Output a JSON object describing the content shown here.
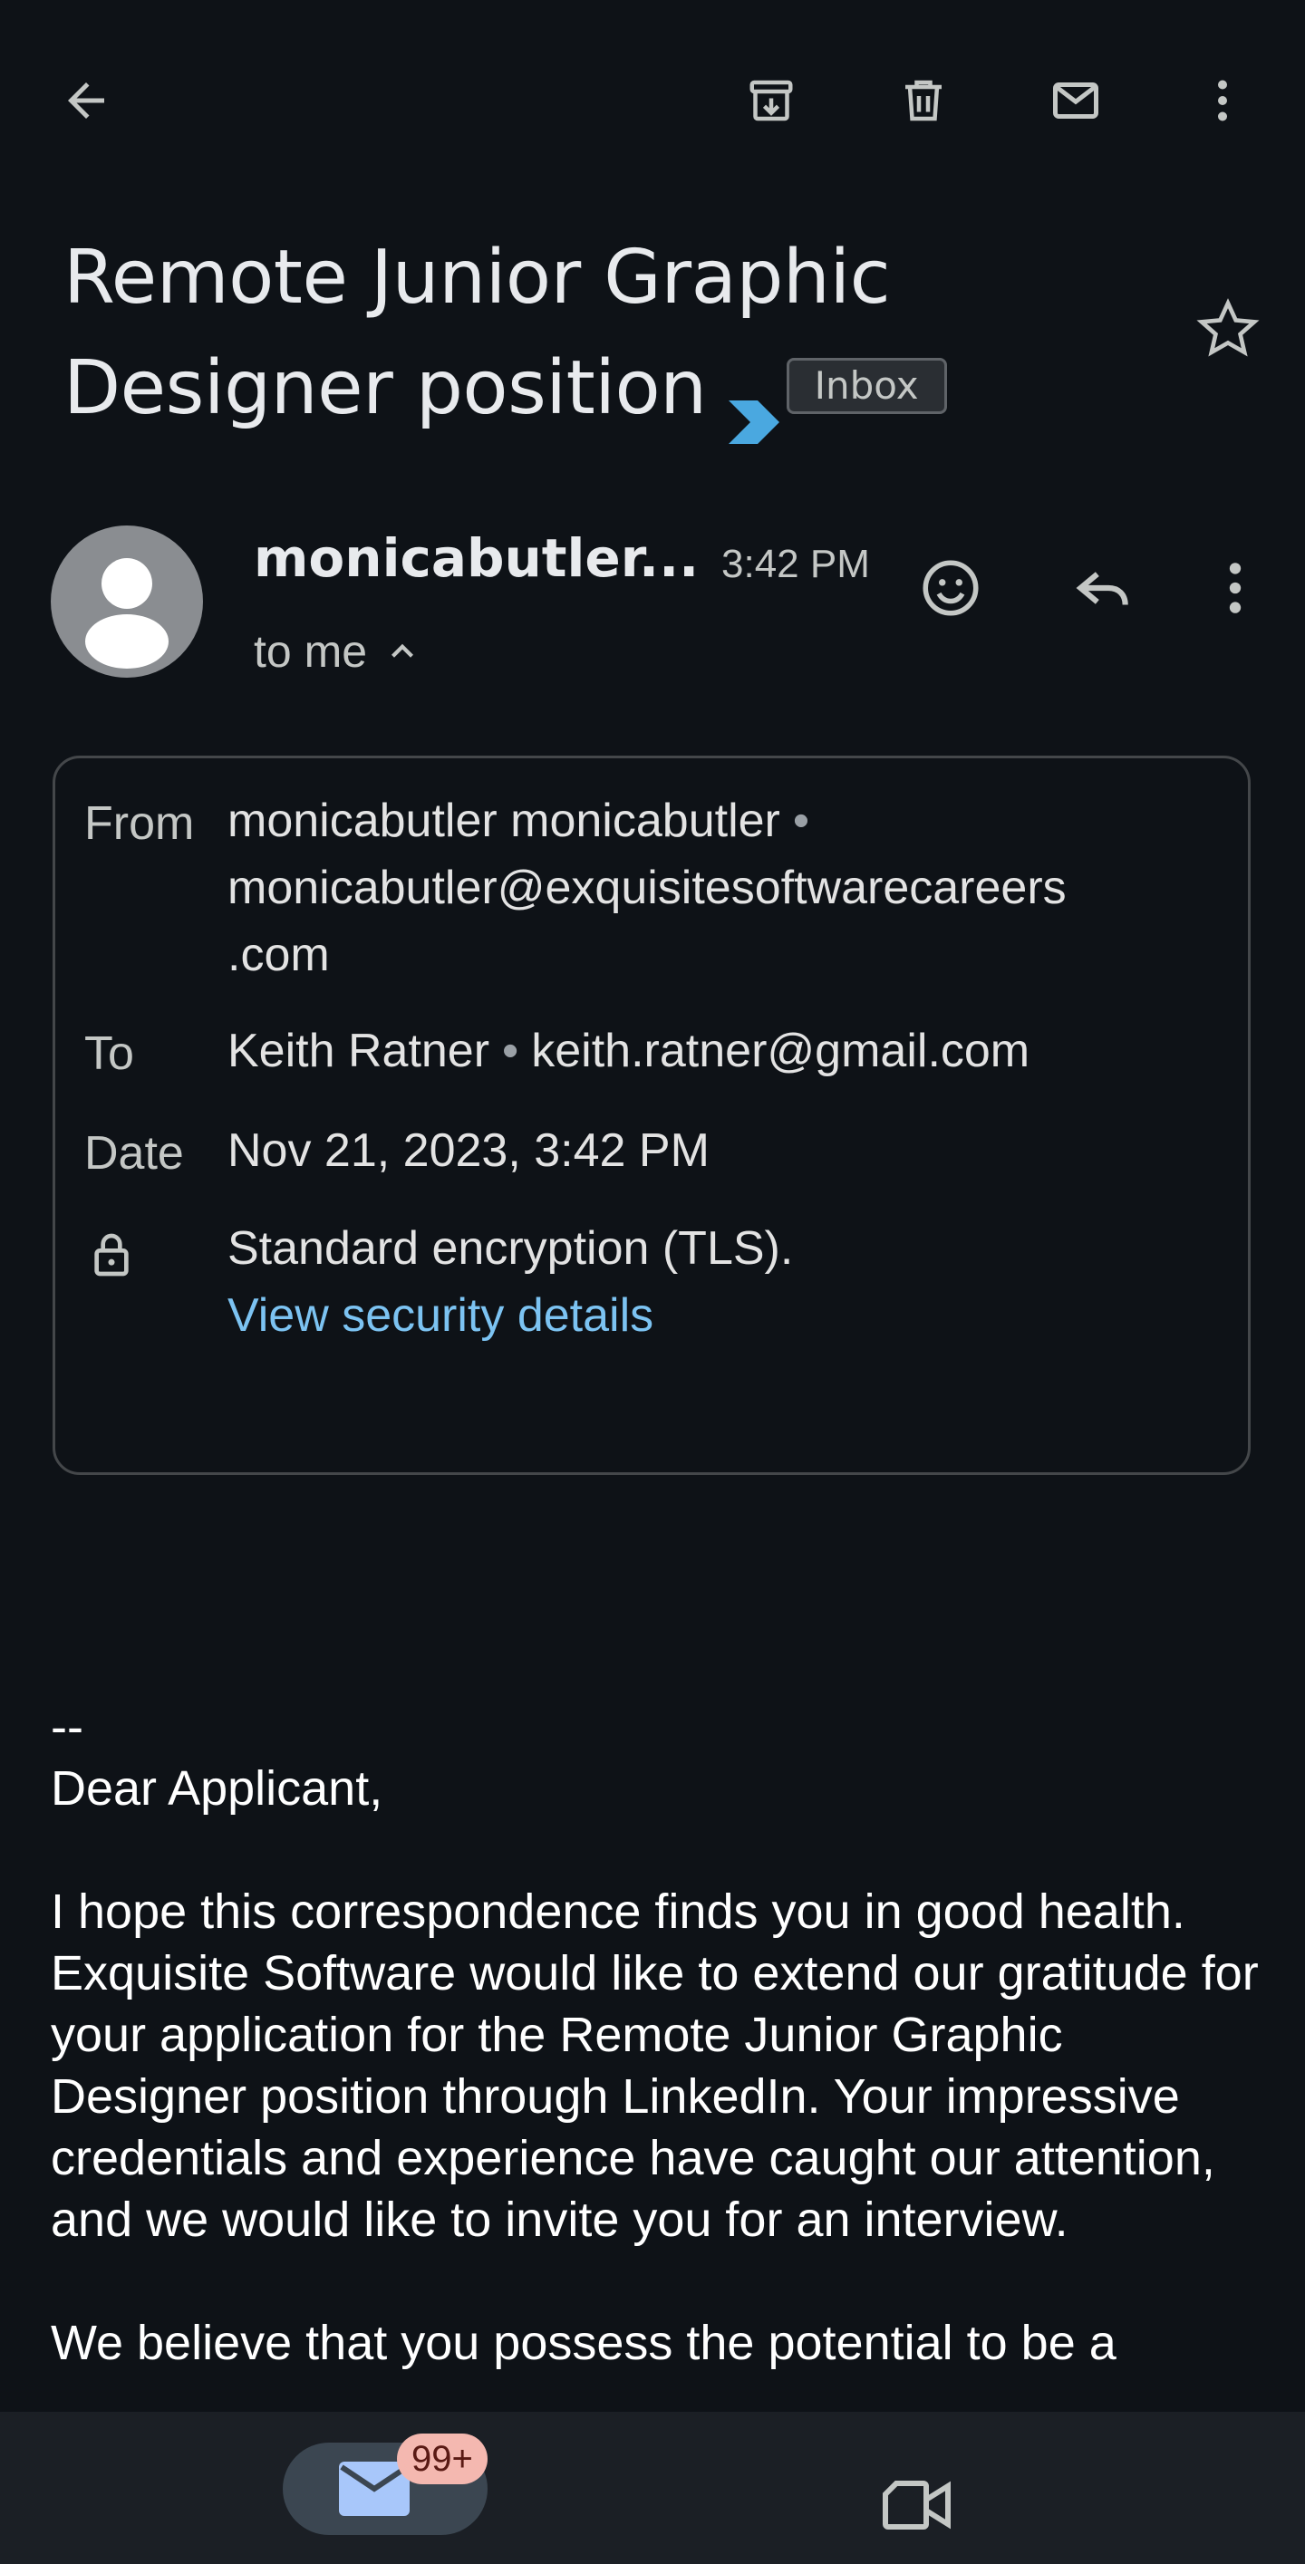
{
  "toolbar": {
    "back": "back-icon",
    "archive": "archive-icon",
    "delete": "delete-icon",
    "mark_unread": "mark-unread-icon",
    "more": "more-vert-icon"
  },
  "email": {
    "subject_line1": "Remote Junior Graphic",
    "subject_line2": "Designer position",
    "label": "Inbox",
    "starred": false,
    "sender_short": "monicabutler...",
    "time": "3:42 PM",
    "to_me": "to me"
  },
  "details": {
    "from_label": "From",
    "from_name": "monicabutler monicabutler",
    "from_email_line1": "monicabutler@exquisitesoftwarecareers",
    "from_email_line2": ".com",
    "to_label": "To",
    "to_name": "Keith Ratner",
    "to_email": "keith.ratner@gmail.com",
    "date_label": "Date",
    "date_value": "Nov 21, 2023, 3:42 PM",
    "encryption": "Standard encryption (TLS).",
    "security_link": "View security details"
  },
  "body": {
    "separator": "--",
    "greeting": "Dear Applicant,",
    "paragraph1": "I hope this correspondence finds you in good health. Exquisite Software would like to extend our gratitude for your application for the Remote Junior Graphic Designer position through LinkedIn. Your impressive credentials and experience have caught our attention, and we would like to invite you for an interview.",
    "paragraph2_partial": "We believe that you possess the potential to be a"
  },
  "bottom_nav": {
    "mail_badge": "99+"
  },
  "colors": {
    "background": "#0e1217",
    "link": "#7cc3f2",
    "importance_marker": "#4aa8e0",
    "badge": "#f4b8b0"
  }
}
